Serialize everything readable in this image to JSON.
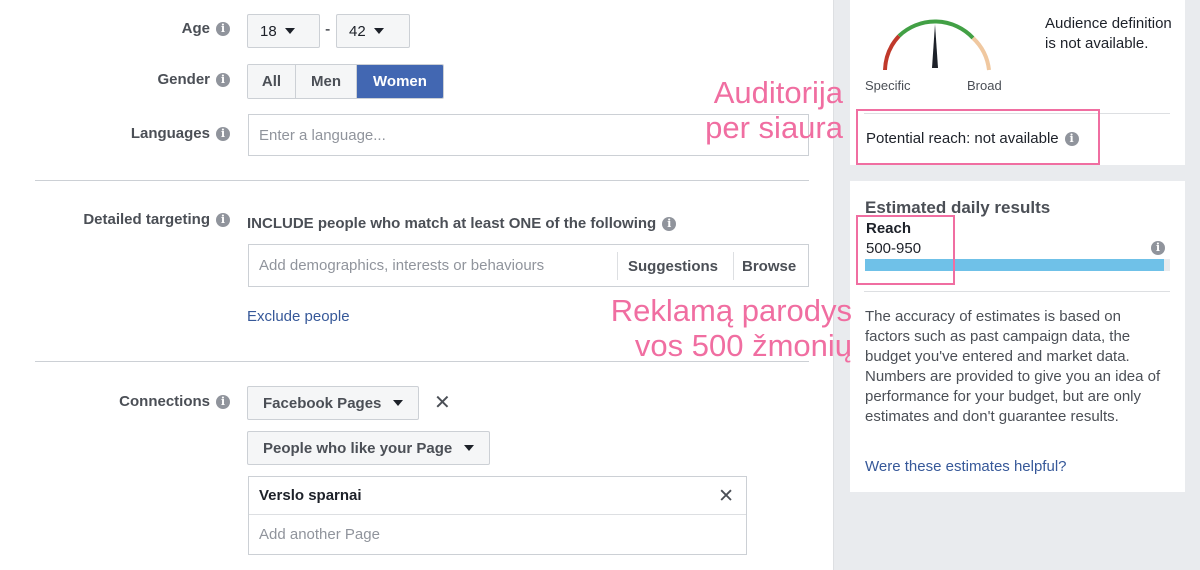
{
  "age": {
    "label": "Age",
    "min": "18",
    "max": "42",
    "separator": "-"
  },
  "gender": {
    "label": "Gender",
    "options": [
      "All",
      "Men",
      "Women"
    ],
    "selected": "Women"
  },
  "languages": {
    "label": "Languages",
    "placeholder": "Enter a language..."
  },
  "detailed_targeting": {
    "label": "Detailed targeting",
    "include_text": "INCLUDE people who match at least ONE of the following",
    "placeholder": "Add demographics, interests or behaviours",
    "suggestions": "Suggestions",
    "browse": "Browse",
    "exclude_link": "Exclude people"
  },
  "connections": {
    "label": "Connections",
    "type_select": "Facebook Pages",
    "condition_select": "People who like your Page",
    "pages": [
      "Verslo sparnai"
    ],
    "add_placeholder": "Add another Page"
  },
  "audience": {
    "specific_label": "Specific",
    "broad_label": "Broad",
    "definition_text": "Audience definition is not available.",
    "potential_reach": "Potential reach: not available"
  },
  "estimated": {
    "title": "Estimated daily results",
    "reach_label": "Reach",
    "reach_value": "500-950",
    "reach_fill_fraction": 0.98,
    "accuracy_text": "The accuracy of estimates is based on factors such as past campaign data, the budget you've entered and market data. Numbers are provided to give you an idea of performance for your budget, but are only estimates and don't guarantee results.",
    "helpful_link": "Were these estimates helpful?"
  },
  "annotations": {
    "audience_note_line1": "Auditorija",
    "audience_note_line2": "per siaura",
    "reach_note_line1": "Reklamą parodys",
    "reach_note_line2": "vos 500 žmonių"
  },
  "colors": {
    "accent": "#4267b2",
    "link": "#365899",
    "annotation": "#f06ea1",
    "reach_bar": "#6fc1e8"
  }
}
